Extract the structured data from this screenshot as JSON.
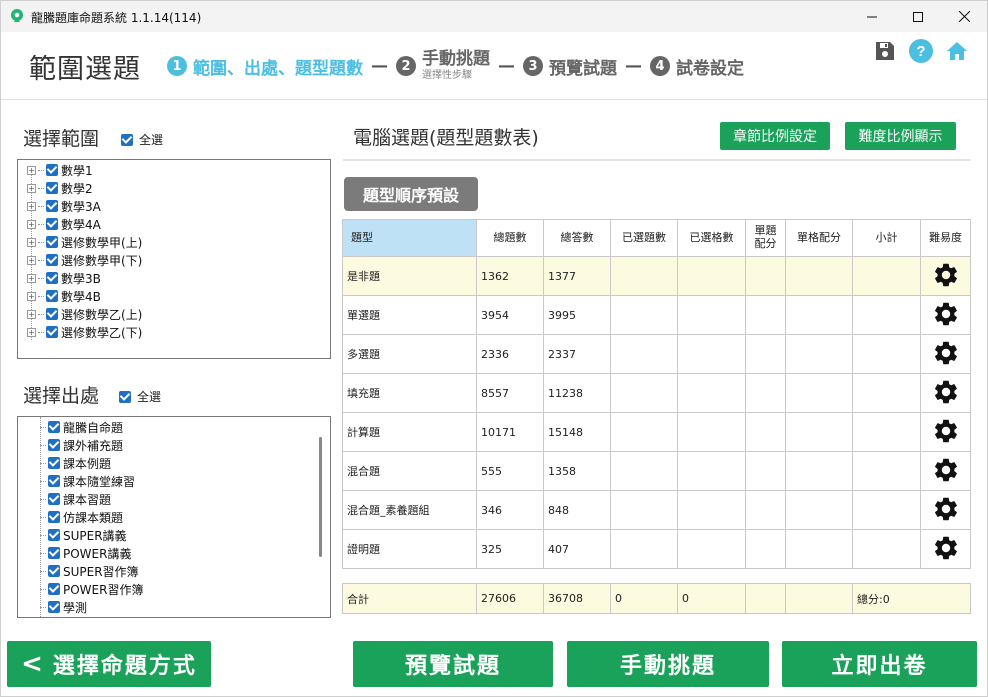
{
  "window": {
    "title": "龍騰題庫命題系統 1.1.14(114)"
  },
  "header": {
    "page_title": "範圍選題",
    "steps": [
      {
        "num": "1",
        "label": "範圍、出處、題型題數"
      },
      {
        "num": "2",
        "label": "手動挑題",
        "sub": "選擇性步驟"
      },
      {
        "num": "3",
        "label": "預覽試題"
      },
      {
        "num": "4",
        "label": "試卷設定"
      }
    ],
    "dash": "—",
    "help_glyph": "?"
  },
  "scope": {
    "title": "選擇範圍",
    "select_all": "全選",
    "items": [
      "數學1",
      "數學2",
      "數學3A",
      "數學4A",
      "選修數學甲(上)",
      "選修數學甲(下)",
      "數學3B",
      "數學4B",
      "選修數學乙(上)",
      "選修數學乙(下)"
    ]
  },
  "source": {
    "title": "選擇出處",
    "select_all": "全選",
    "items": [
      "龍騰自命題",
      "課外補充題",
      "課本例題",
      "課本隨堂練習",
      "課本習題",
      "仿課本類題",
      "SUPER講義",
      "POWER講義",
      "SUPER習作簿",
      "POWER習作簿",
      "學測"
    ]
  },
  "right": {
    "title": "電腦選題(題型題數表)",
    "chapter_ratio_button": "章節比例設定",
    "difficulty_ratio_button": "難度比例顯示",
    "type_order_button": "題型順序預設"
  },
  "table": {
    "headers": [
      "題型",
      "總題數",
      "總答數",
      "已選題數",
      "已選格數",
      "單題\n配分",
      "單格配分",
      "小計",
      "難易度"
    ],
    "rows": [
      {
        "type": "是非題",
        "total_q": "1362",
        "total_a": "1377"
      },
      {
        "type": "單選題",
        "total_q": "3954",
        "total_a": "3995"
      },
      {
        "type": "多選題",
        "total_q": "2336",
        "total_a": "2337"
      },
      {
        "type": "填充題",
        "total_q": "8557",
        "total_a": "11238"
      },
      {
        "type": "計算題",
        "total_q": "10171",
        "total_a": "15148"
      },
      {
        "type": "混合題",
        "total_q": "555",
        "total_a": "1358"
      },
      {
        "type": "混合題_素養題組",
        "total_q": "346",
        "total_a": "848"
      },
      {
        "type": "證明題",
        "total_q": "325",
        "total_a": "407"
      }
    ],
    "totals": {
      "label": "合計",
      "total_q": "27606",
      "total_a": "36708",
      "sel_q": "0",
      "sel_cells": "0",
      "score": "總分:0"
    }
  },
  "bottom": {
    "back_button": "選擇命題方式",
    "back_chevron": "<",
    "preview_button": "預覽試題",
    "manual_button": "手動挑題",
    "generate_button": "立即出卷"
  },
  "colors": {
    "accent_green": "#1aa15a",
    "active_step": "#4cbfe0",
    "selected_row": "#fcfbe0",
    "header_type": "#bfe1f6"
  }
}
